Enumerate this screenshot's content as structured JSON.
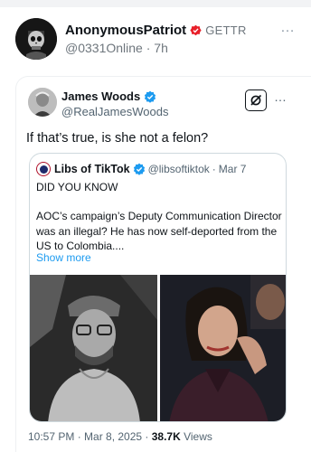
{
  "outer_post": {
    "author_name": "AnonymousPatriot",
    "platform_label": "GETTR",
    "handle": "@0331Online",
    "separator": "·",
    "time": "7h",
    "more_icon": "…"
  },
  "x_post": {
    "author_name": "James Woods",
    "handle": "@RealJamesWoods",
    "more_icon": "…",
    "text": "If that’s true, is she not a felon?",
    "timestamp": "10:57 PM · Mar 8, 2025 · ",
    "views_count": "38.7K",
    "views_label": " Views"
  },
  "quoted_post": {
    "author_name": "Libs of TikTok",
    "handle": "@libsoftiktok",
    "separator": "·",
    "date": "Mar 7",
    "paragraph1": "DID YOU KNOW",
    "paragraph2": "AOC’s campaign’s Deputy Communication Director was an illegal? He has now self-deported from the US to Colombia....",
    "show_more": "Show more"
  },
  "colors": {
    "verified_blue": "#1d9bf0",
    "gettr_red": "#e8202a",
    "link_blue": "#1d9bf0",
    "secondary_text": "#536471"
  },
  "icons": [
    "skull-avatar",
    "gettr-verified-icon",
    "verified-icon",
    "grok-icon",
    "more-icon"
  ]
}
